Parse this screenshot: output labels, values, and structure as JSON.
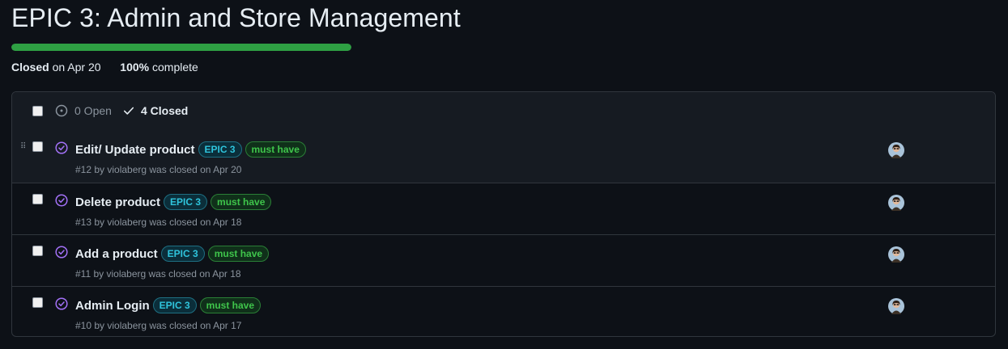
{
  "milestone": {
    "title": "EPIC 3: Admin and Store Management",
    "status": "Closed",
    "closed_text": "on Apr 20",
    "percent": "100%",
    "percent_suffix": "complete",
    "progress_fraction": 1.0
  },
  "list_header": {
    "open_label": "0 Open",
    "closed_label": "4 Closed"
  },
  "issues": [
    {
      "title": "Edit/ Update product",
      "labels": [
        "EPIC 3",
        "must have"
      ],
      "meta": "#12 by violaberg was closed on Apr 20"
    },
    {
      "title": "Delete product",
      "labels": [
        "EPIC 3",
        "must have"
      ],
      "meta": "#13 by violaberg was closed on Apr 18"
    },
    {
      "title": "Add a product",
      "labels": [
        "EPIC 3",
        "must have"
      ],
      "meta": "#11 by violaberg was closed on Apr 18"
    },
    {
      "title": "Admin Login",
      "labels": [
        "EPIC 3",
        "must have"
      ],
      "meta": "#10 by violaberg was closed on Apr 17"
    }
  ],
  "colors": {
    "progress": "#2ea043",
    "closed_icon": "#a371f7",
    "epic_label": "#2fc4dc",
    "must_have_label": "#3fc54b"
  }
}
